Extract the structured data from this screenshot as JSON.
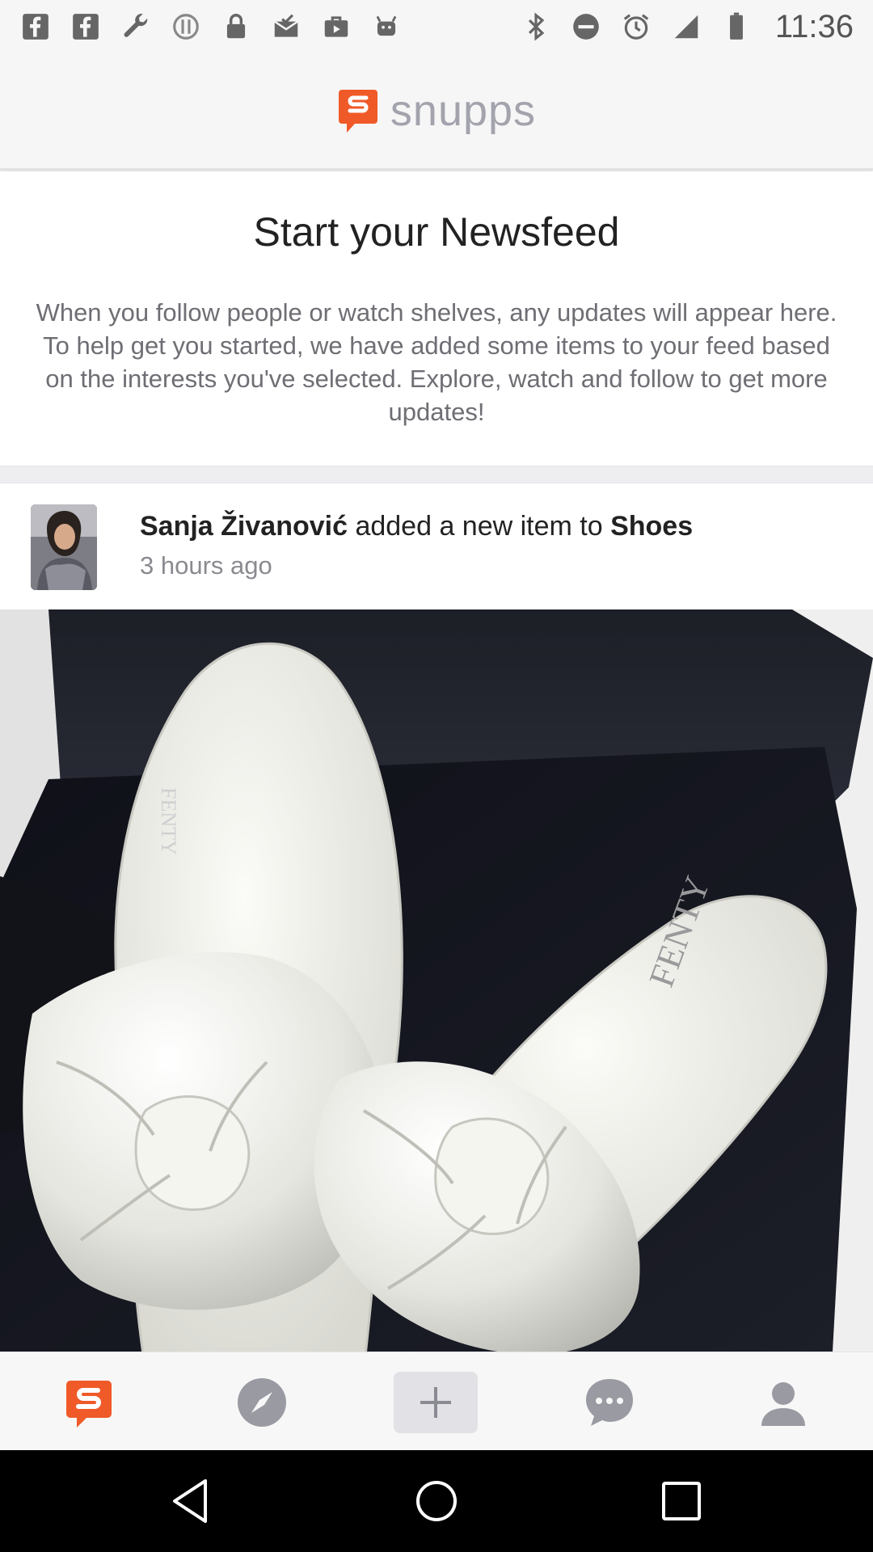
{
  "status_bar": {
    "time": "11:36",
    "left_icons": [
      "facebook-icon",
      "facebook-icon",
      "wrench-icon",
      "circle-info-icon",
      "lock-icon",
      "mail-check-icon",
      "briefcase-icon",
      "android-icon"
    ],
    "right_icons": [
      "bluetooth-icon",
      "do-not-disturb-icon",
      "alarm-icon",
      "signal-icon",
      "battery-icon"
    ]
  },
  "header": {
    "brand_name": "snupps",
    "brand_color": "#f05a28"
  },
  "intro": {
    "title": "Start your Newsfeed",
    "body": "When you follow people or watch shelves, any updates will appear here. To help get you started, we have added some items to your feed based on the interests you've selected. Explore, watch and follow to get more updates!"
  },
  "feed_item": {
    "user_name": "Sanja Živanović",
    "action_text": " added a new item to ",
    "shelf_name": "Shoes",
    "time_ago": "3 hours ago",
    "image_label": "FENTY"
  },
  "bottom_nav": {
    "items": [
      {
        "name": "home",
        "icon": "snupps-logo-icon",
        "active": true
      },
      {
        "name": "explore",
        "icon": "compass-icon"
      },
      {
        "name": "add",
        "icon": "plus-icon"
      },
      {
        "name": "messages",
        "icon": "chat-icon"
      },
      {
        "name": "profile",
        "icon": "person-icon"
      }
    ],
    "active_color": "#f05a28",
    "inactive_color": "#9a9aa2"
  },
  "system_nav": {
    "items": [
      "back-icon",
      "home-icon",
      "recents-icon"
    ]
  }
}
